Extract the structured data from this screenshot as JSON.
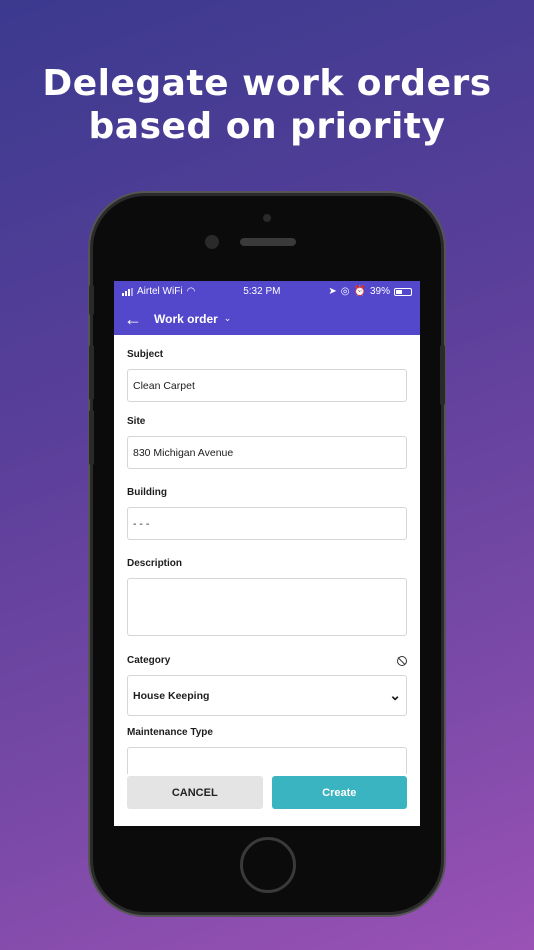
{
  "headline": {
    "line1": "Delegate work orders",
    "line2": "based on priority"
  },
  "status_bar": {
    "carrier": "Airtel WiFi",
    "time": "5:32 PM",
    "battery": "39%"
  },
  "app_bar": {
    "title": "Work order"
  },
  "form": {
    "subject": {
      "label": "Subject",
      "value": "Clean Carpet"
    },
    "site": {
      "label": "Site",
      "value": "830 Michigan Avenue"
    },
    "building": {
      "label": "Building",
      "value": "- - -"
    },
    "description": {
      "label": "Description",
      "value": ""
    },
    "category": {
      "label": "Category",
      "value": "House Keeping"
    },
    "maintenance_type": {
      "label": "Maintenance Type",
      "value": ""
    }
  },
  "actions": {
    "cancel": "CANCEL",
    "create": "Create"
  },
  "colors": {
    "primary": "#5347cc",
    "create_button": "#3bb4c1",
    "cancel_button": "#e4e4e4"
  }
}
